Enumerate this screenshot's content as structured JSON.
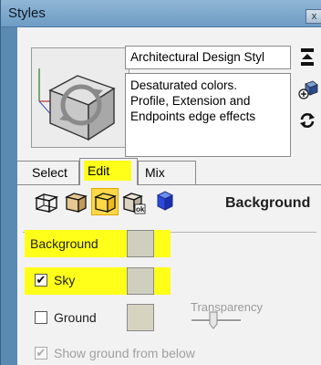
{
  "window": {
    "title": "Styles",
    "close_label": "x"
  },
  "style": {
    "name": "Architectural Design Styl",
    "description_lines": [
      "Desaturated colors.",
      "Profile, Extension and",
      "Endpoints edge effects"
    ]
  },
  "tabs": [
    {
      "label": "Select"
    },
    {
      "label": "Edit"
    },
    {
      "label": "Mix"
    }
  ],
  "edit_panel": {
    "section_title": "Background",
    "background_label": "Background",
    "sky_label": "Sky",
    "sky_checked": true,
    "ground_label": "Ground",
    "ground_checked": false,
    "transparency_label": "Transparency",
    "show_ground_label": "Show ground from below",
    "show_ground_checked": true,
    "colors": {
      "background": "#cfcfbf",
      "sky": "#cfcfbf",
      "ground": "#d6d3c1",
      "highlight": "#ffff1a"
    }
  },
  "icons": {
    "update_style": "update-icon",
    "create_style": "create-style-icon",
    "refresh": "refresh-icon",
    "edge_settings": "edge-settings-icon",
    "face_settings": "face-settings-icon",
    "background_settings": "background-settings-icon",
    "watermark_settings": "watermark-settings-icon",
    "modeling_settings": "modeling-settings-icon"
  }
}
